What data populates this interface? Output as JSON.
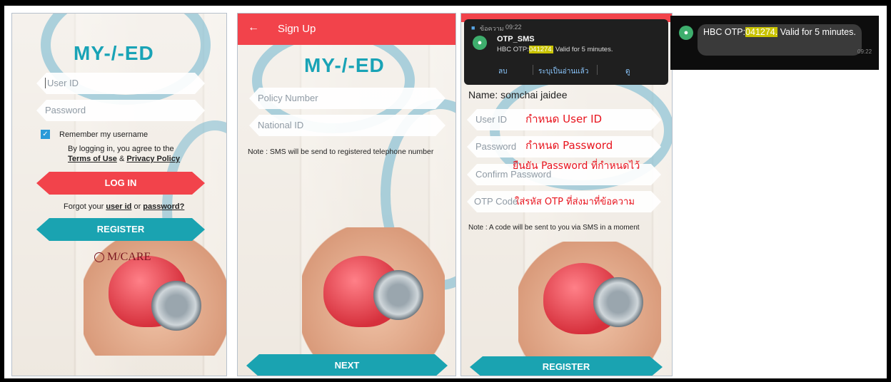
{
  "login": {
    "logo": "MY-/-ED",
    "user_id_placeholder": "User ID",
    "password_placeholder": "Password",
    "remember": "Remember my username",
    "agree_prefix": "By logging in, you agree to the",
    "terms": "Terms of Use",
    "and": "&",
    "privacy": "Privacy Policy",
    "login_button": "LOG IN",
    "forgot_prefix": "Forgot your",
    "user_id_link": "user id",
    "or": "or",
    "password_link": "password?",
    "register_button": "REGISTER",
    "mcare": "M/CARE"
  },
  "signup": {
    "header_title": "Sign Up",
    "back_arrow": "←",
    "policy_placeholder": "Policy Number",
    "national_placeholder": "National ID",
    "note": "Note : SMS will be send to registered telephone number",
    "next_button": "NEXT"
  },
  "register": {
    "notif_app": "ข้อความ",
    "notif_time": "09:22",
    "notif_sender": "OTP_SMS",
    "notif_prefix": "HBC OTP:",
    "notif_code": "041274.",
    "notif_suffix": "Valid for 5 minutes.",
    "action_delete": "ลบ",
    "action_mark_read": "ระบุเป็นอ่านแล้ว",
    "action_view": "ดู",
    "name_line": "Name: somchai jaidee",
    "user_id_placeholder": "User ID",
    "password_placeholder": "Password",
    "confirm_placeholder": "Confirm Password",
    "otp_placeholder": "OTP Code",
    "annot_user": "กำหนด User ID",
    "annot_password": "กำหนด Password",
    "annot_confirm": "ยืนยัน Password ที่กำหนดไว้",
    "annot_otp": "ใส่รหัส OTP ที่ส่งมาที่ข้อความ",
    "note": "Note : A code will be sent to you via SMS in a moment",
    "register_button": "REGISTER"
  },
  "sms": {
    "prefix": "HBC OTP:",
    "code": "041274.",
    "suffix": "Valid for 5 minutes.",
    "time": "09:22"
  },
  "colors": {
    "accent_red": "#f2434b",
    "accent_teal": "#1aa3b1",
    "highlight": "#c9c300"
  },
  "icons": [
    "check-icon",
    "back-arrow-icon",
    "message-icon",
    "person-icon"
  ]
}
